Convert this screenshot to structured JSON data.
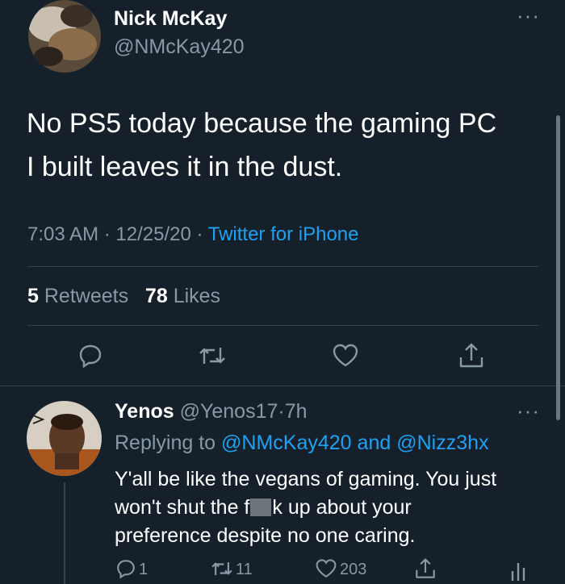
{
  "tweet": {
    "author_name": "Nick McKay",
    "author_handle": "@NMcKay420",
    "text_line1": "No PS5 today because the gaming PC",
    "text_line2": "I built leaves it in the dust.",
    "time": "7:03 AM",
    "date": "12/25/20",
    "separator": "·",
    "source": "Twitter for iPhone",
    "retweets_count": "5",
    "retweets_label": "Retweets",
    "likes_count": "78",
    "likes_label": "Likes"
  },
  "reply": {
    "author_name": "Yenos",
    "author_handle": "@Yenos17",
    "age": "7h",
    "replying_prefix": "Replying to",
    "replying_to_1": "@NMcKay420",
    "replying_and": "and",
    "replying_to_2": "@Nizz3hx",
    "text_line1": "Y'all be like the vegans of gaming. You just",
    "text_line2_a": "won't shut the f",
    "text_line2_b": "k up about your",
    "text_line3": "preference despite no one caring.",
    "reply_count": "1",
    "retweet_count": "11",
    "like_count": "203"
  },
  "icons": {
    "more": "more-icon",
    "reply": "reply-icon",
    "retweet": "retweet-icon",
    "like": "heart-icon",
    "share": "share-icon",
    "analytics": "analytics-icon"
  }
}
